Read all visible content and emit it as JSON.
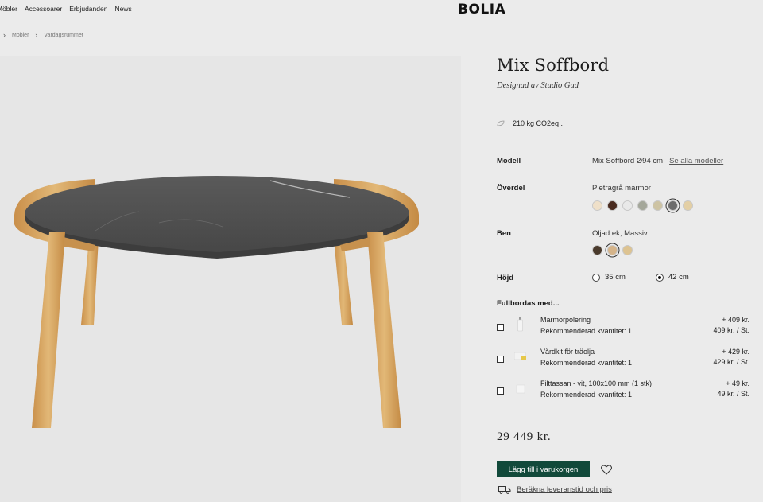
{
  "nav": {
    "items": [
      "Möbler",
      "Accessoarer",
      "Erbjudanden",
      "News"
    ],
    "logo": "BOLIA"
  },
  "breadcrumb": {
    "items": [
      "Möbler",
      "Vardagsrummet"
    ]
  },
  "product": {
    "title": "Mix Soffbord",
    "designer": "Designad av Studio Gud",
    "co2": "210 kg CO2eq ."
  },
  "options": {
    "model_label": "Modell",
    "model_value": "Mix Soffbord Ø94 cm",
    "model_link": "Se alla modeller",
    "top_label": "Överdel",
    "top_value": "Pietragrå marmor",
    "top_swatches": [
      "#efe0c9",
      "#4a2b1f",
      "#e9e9e9",
      "#a4a79a",
      "#cdc3a3",
      "#6d6d6d",
      "#e3cfa5"
    ],
    "top_selected": 5,
    "legs_label": "Ben",
    "legs_value": "Oljad ek, Massiv",
    "legs_swatches": [
      "#4a3a2c",
      "#d5b48a",
      "#ddc391"
    ],
    "legs_selected": 1,
    "height_label": "Höjd",
    "height_options": [
      "35 cm",
      "42 cm"
    ],
    "height_selected": 1
  },
  "complete": {
    "title": "Fullbordas med...",
    "items": [
      {
        "name": "Marmorpolering",
        "qty": "Rekommenderad kvantitet: 1",
        "price": "+ 409 kr.",
        "unit": "409 kr. / St."
      },
      {
        "name": "Vårdkit för träolja",
        "qty": "Rekommenderad kvantitet: 1",
        "price": "+ 429 kr.",
        "unit": "429 kr. / St."
      },
      {
        "name": "Filttassan - vit, 100x100 mm (1 stk)",
        "qty": "Rekommenderad kvantitet: 1",
        "price": "+ 49 kr.",
        "unit": "49 kr. / St."
      }
    ]
  },
  "checkout": {
    "total": "29 449 kr.",
    "add_button": "Lägg till i varukorgen",
    "delivery": "Beräkna leveranstid och pris"
  },
  "colors": {
    "accent": "#11493a",
    "marble": "#4e4e4e",
    "oak": "#d7a766"
  }
}
